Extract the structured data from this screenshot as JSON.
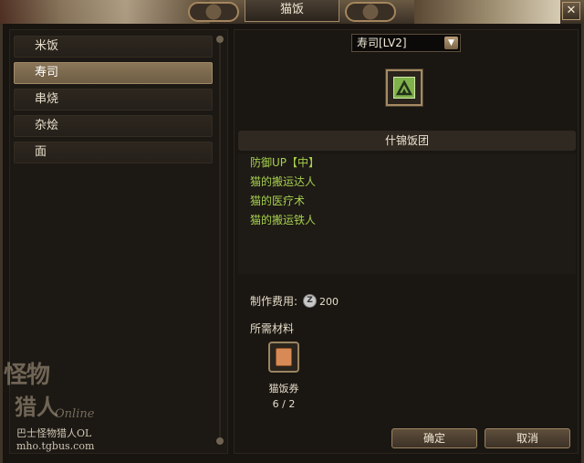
{
  "window": {
    "title": "猫饭",
    "close_label": "✕"
  },
  "categories": [
    {
      "label": "米饭",
      "selected": false
    },
    {
      "label": "寿司",
      "selected": true
    },
    {
      "label": "串烧",
      "selected": false
    },
    {
      "label": "杂烩",
      "selected": false
    },
    {
      "label": "面",
      "selected": false
    }
  ],
  "dish_select": {
    "value": "寿司[LV2]"
  },
  "dish": {
    "name": "什锦饭团",
    "icon": "sushi-dish-icon",
    "skills": [
      "防御UP【中】",
      "猫的搬运达人",
      "猫的医疗术",
      "猫的搬运铁人"
    ]
  },
  "cost": {
    "label": "制作费用:",
    "currency_icon": "zenny-icon",
    "currency_glyph": "Z",
    "value": "200"
  },
  "materials": {
    "title": "所需材料",
    "items": [
      {
        "name": "猫饭券",
        "count": "6 / 2",
        "icon": "ticket-icon"
      }
    ]
  },
  "buttons": {
    "ok": "确定",
    "cancel": "取消"
  },
  "watermark": {
    "logo_line1": "怪物",
    "logo_line2": "猎人",
    "logo_online": "Online",
    "line1": "巴士怪物猎人OL",
    "line2": "mho.tgbus.com"
  },
  "colors": {
    "skill_text": "#a6d04e",
    "selected_category": "#8a7657",
    "accent_border": "#a68a63"
  }
}
